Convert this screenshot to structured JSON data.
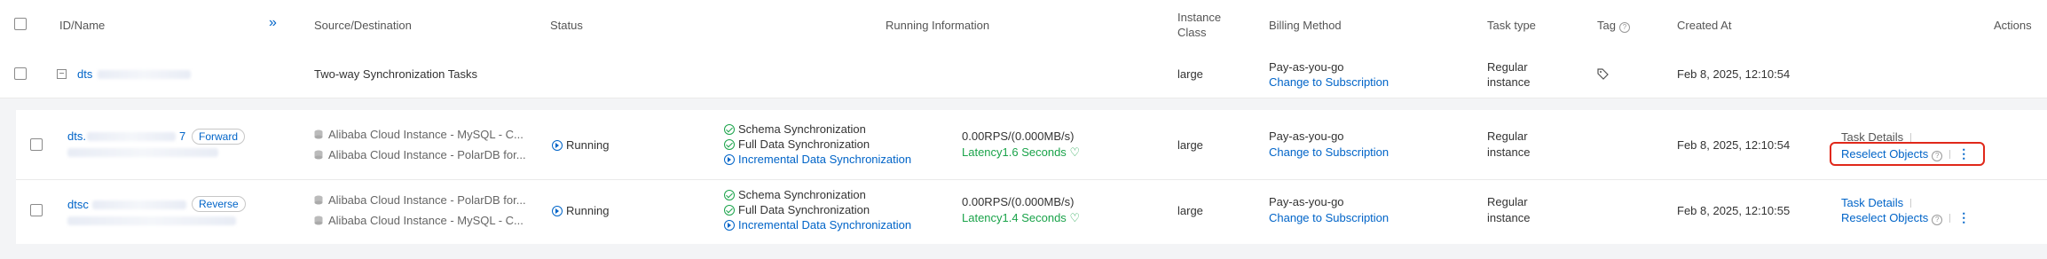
{
  "columns": {
    "id_name": "ID/Name",
    "expand_icon": "»",
    "source_destination": "Source/Destination",
    "status": "Status",
    "running_information": "Running Information",
    "instance_class_line1": "Instance",
    "instance_class_line2": "Class",
    "billing_method": "Billing Method",
    "task_type": "Task type",
    "tag": "Tag",
    "created_at": "Created At",
    "actions": "Actions"
  },
  "group_row": {
    "id_prefix": "dts",
    "source_destination": "Two-way Synchronization Tasks",
    "instance_class": "large",
    "billing_method": "Pay-as-you-go",
    "billing_link": "Change to Subscription",
    "task_type_line1": "Regular",
    "task_type_line2": "instance",
    "created_at": "Feb 8, 2025, 12:10:54"
  },
  "tasks": [
    {
      "id_prefix": "dts.",
      "id_suffix": "7",
      "direction": "Forward",
      "source": "Alibaba Cloud Instance - MySQL - C...",
      "destination": "Alibaba Cloud Instance - PolarDB for...",
      "status": "Running",
      "steps": [
        "Schema Synchronization",
        "Full Data Synchronization",
        "Incremental Data Synchronization"
      ],
      "rps": "0.00RPS/(0.000MB/s)",
      "latency": "Latency1.6 Seconds",
      "instance_class": "large",
      "billing_method": "Pay-as-you-go",
      "billing_link": "Change to Subscription",
      "task_type_line1": "Regular",
      "task_type_line2": "instance",
      "created_at": "Feb 8, 2025, 12:10:54",
      "action_details": "Task Details",
      "action_reselect": "Reselect Objects"
    },
    {
      "id_prefix": "dtsc",
      "id_suffix": "",
      "direction": "Reverse",
      "source": "Alibaba Cloud Instance - PolarDB for...",
      "destination": "Alibaba Cloud Instance - MySQL - C...",
      "status": "Running",
      "steps": [
        "Schema Synchronization",
        "Full Data Synchronization",
        "Incremental Data Synchronization"
      ],
      "rps": "0.00RPS/(0.000MB/s)",
      "latency": "Latency1.4 Seconds",
      "instance_class": "large",
      "billing_method": "Pay-as-you-go",
      "billing_link": "Change to Subscription",
      "task_type_line1": "Regular",
      "task_type_line2": "instance",
      "created_at": "Feb 8, 2025, 12:10:55",
      "action_details": "Task Details",
      "action_reselect": "Reselect Objects"
    }
  ],
  "icons": {
    "more": "⋮",
    "help": "?",
    "collapse": "−"
  },
  "colors": {
    "link": "#0064c8",
    "success": "#1aa34a",
    "highlight": "#e0281a"
  }
}
